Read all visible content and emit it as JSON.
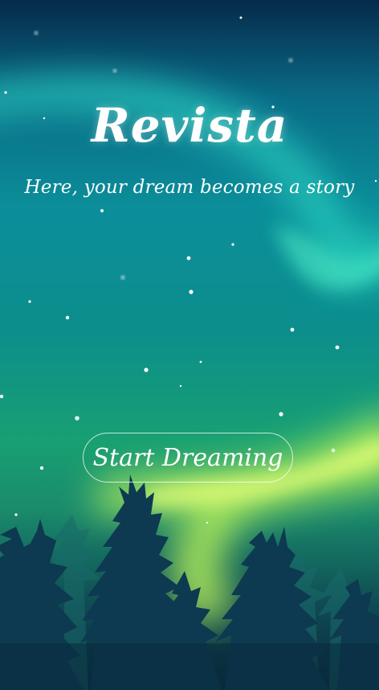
{
  "app": {
    "title": "Revista",
    "tagline": "Here, your dream becomes a story"
  },
  "actions": {
    "start_label": "Start Dreaming"
  },
  "colors": {
    "sky_top": "#062a4a",
    "sky_mid": "#0b8e9a",
    "aurora_green": "#3fe8b0",
    "aurora_yellow": "#d8ff6a",
    "tree_silhouette": "#0d3a50",
    "text": "#ffffff"
  },
  "icons": {
    "stars": "star-icon",
    "trees": "pine-tree-silhouette"
  }
}
